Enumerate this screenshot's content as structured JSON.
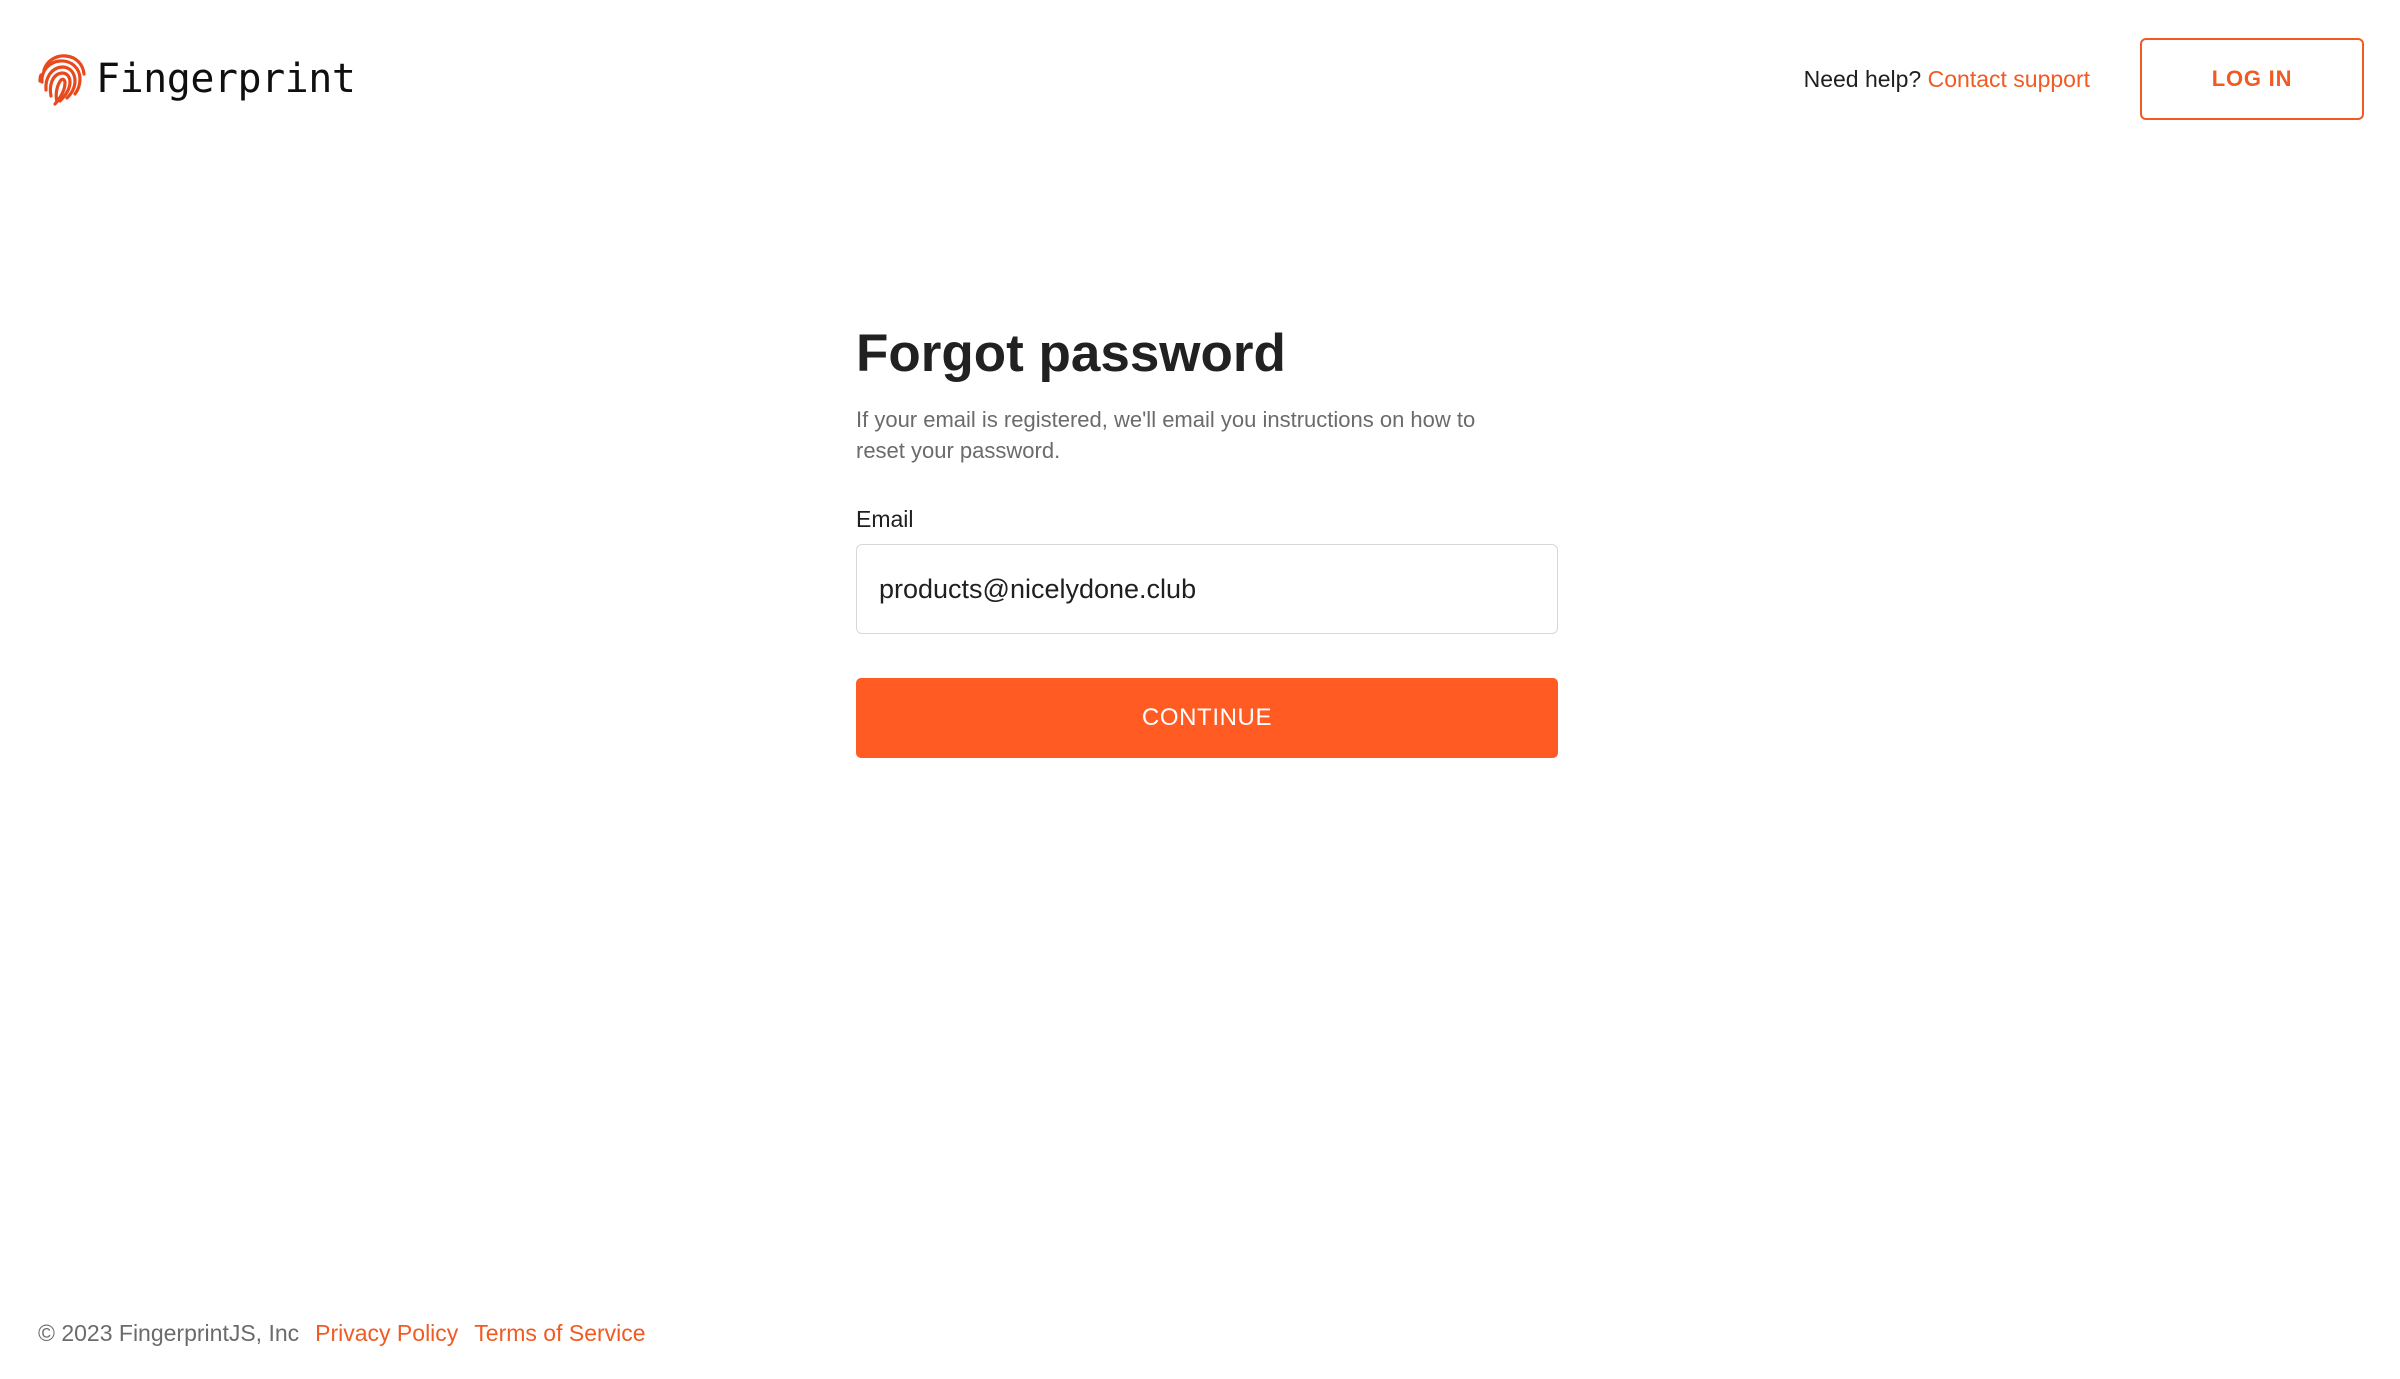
{
  "brand": {
    "name": "Fingerprint",
    "logo_icon": "fingerprint-icon",
    "accent_color": "#f15a22"
  },
  "header": {
    "help_text": "Need help?",
    "contact_link": "Contact support",
    "login_label": "LOG IN"
  },
  "form": {
    "title": "Forgot password",
    "subtitle": "If your email is registered, we'll email you instructions on how to reset your password.",
    "email_label": "Email",
    "email_value": "products@nicelydone.club",
    "continue_label": "CONTINUE",
    "button_color": "#ff5b22"
  },
  "footer": {
    "copyright": "© 2023 FingerprintJS, Inc",
    "privacy_link": "Privacy Policy",
    "terms_link": "Terms of Service"
  }
}
